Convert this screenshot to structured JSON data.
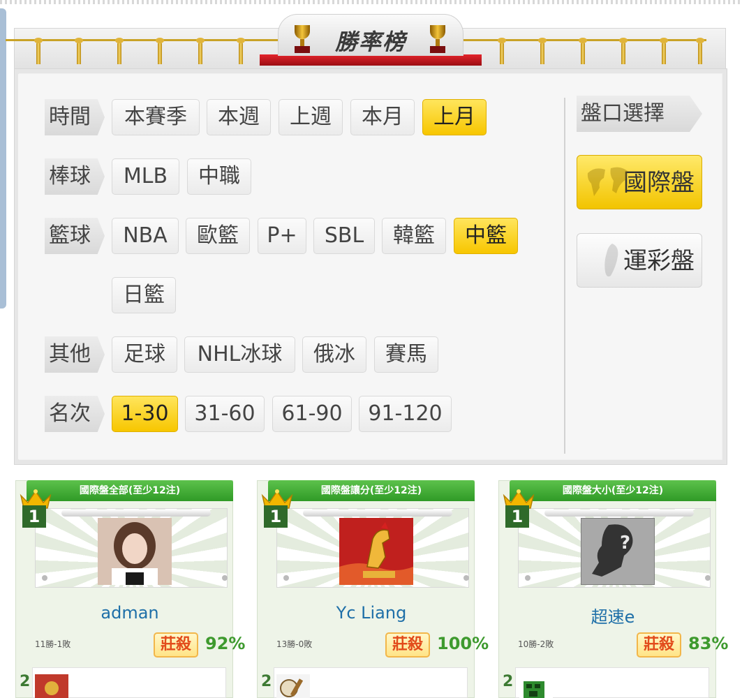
{
  "header": {
    "title": "勝率榜"
  },
  "filters": {
    "time": {
      "label": "時間",
      "options": [
        "本賽季",
        "本週",
        "上週",
        "本月",
        "上月"
      ],
      "selected": "上月"
    },
    "baseball": {
      "label": "棒球",
      "options": [
        "MLB",
        "中職"
      ]
    },
    "basketball": {
      "label": "籃球",
      "options": [
        "NBA",
        "歐籃",
        "P+",
        "SBL",
        "韓籃",
        "中籃",
        "日籃"
      ],
      "selected": "中籃"
    },
    "other": {
      "label": "其他",
      "options": [
        "足球",
        "NHL冰球",
        "俄冰",
        "賽馬"
      ]
    },
    "rank": {
      "label": "名次",
      "options": [
        "1-30",
        "31-60",
        "61-90",
        "91-120"
      ],
      "selected": "1-30"
    }
  },
  "market": {
    "label": "盤口選擇",
    "options": [
      "國際盤",
      "運彩盤"
    ],
    "selected": "國際盤"
  },
  "cards": [
    {
      "title": "國際盤全部(至少12注)",
      "rank": "1",
      "name": "adman",
      "record": "11勝-1敗",
      "badge": "莊殺",
      "percent": "92%",
      "next_rank": "2"
    },
    {
      "title": "國際盤讓分(至少12注)",
      "rank": "1",
      "name": "Yc Liang",
      "record": "13勝-0敗",
      "badge": "莊殺",
      "percent": "100%",
      "next_rank": "2"
    },
    {
      "title": "國際盤大小(至少12注)",
      "rank": "1",
      "name": "超速e",
      "record": "10勝-2敗",
      "badge": "莊殺",
      "percent": "83%",
      "next_rank": "2"
    }
  ],
  "colors": {
    "accent_yellow": "#f7c600",
    "card_green": "#2f9a26",
    "name_blue": "#1e6fa8",
    "percent_green": "#3e9a2e",
    "badge_red": "#e24a1a"
  }
}
